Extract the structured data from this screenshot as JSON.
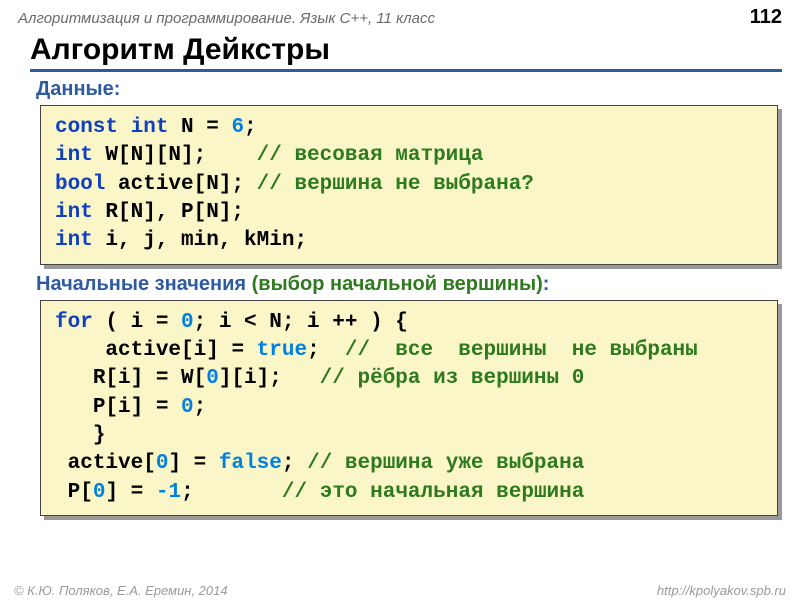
{
  "header": {
    "breadcrumb": "Алгоритмизация и программирование. Язык C++, 11 класс",
    "page": "112"
  },
  "title": "Алгоритм Дейкстры",
  "section1": "Данные:",
  "code1": {
    "l1_a": "const int",
    "l1_b": " N = ",
    "l1_c": "6",
    "l1_d": ";",
    "l2_a": "int",
    "l2_b": " W[N][N];    ",
    "l2_c": "// весовая матрица",
    "l3_a": "bool",
    "l3_b": " active[N]; ",
    "l3_c": "// вершина не выбрана?",
    "l4_a": "int",
    "l4_b": " R[N], P[N];",
    "l5_a": "int",
    "l5_b": " i, j, min, kMin;"
  },
  "section2": {
    "a": "Начальные значения ",
    "b": "(выбор начальной вершины)",
    "c": ":"
  },
  "code2": {
    "l1_a": "for",
    "l1_b": " ( i = ",
    "l1_c": "0",
    "l1_d": "; i < N; i ++ ) {",
    "l2_a": "    active[i] = ",
    "l2_b": "true",
    "l2_c": ";  ",
    "l2_d": "//  все  вершины  не выбраны",
    "l3_a": "   R[i] = W[",
    "l3_b": "0",
    "l3_c": "][i];   ",
    "l3_d": "// рёбра из вершины 0",
    "l4_a": "   P[i] = ",
    "l4_b": "0",
    "l4_c": ";",
    "l5": "   }",
    "l6_a": " active[",
    "l6_b": "0",
    "l6_c": "] = ",
    "l6_d": "false",
    "l6_e": "; ",
    "l6_f": "// вершина уже выбрана",
    "l7_a": " P[",
    "l7_b": "0",
    "l7_c": "] = ",
    "l7_d": "-1",
    "l7_e": ";       ",
    "l7_f": "// это начальная вершина"
  },
  "footer": {
    "left": "© К.Ю. Поляков, Е.А. Еремин, 2014",
    "right": "http://kpolyakov.spb.ru"
  }
}
